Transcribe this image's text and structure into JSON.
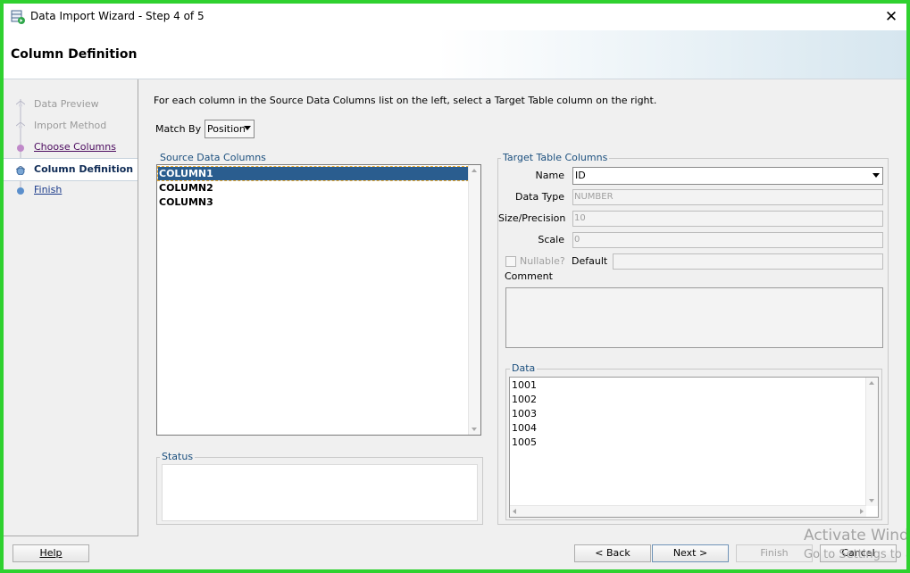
{
  "window": {
    "title": "Data Import Wizard - Step 4 of 5",
    "close_glyph": "✕"
  },
  "header": {
    "title": "Column Definition"
  },
  "nav": {
    "steps": [
      {
        "label": "Data Preview",
        "state": "disabled"
      },
      {
        "label": "Import Method",
        "state": "disabled"
      },
      {
        "label": "Choose Columns",
        "state": "link"
      },
      {
        "label": "Column Definition",
        "state": "current"
      },
      {
        "label": "Finish",
        "state": "link"
      }
    ]
  },
  "content": {
    "instruction": "For each column in the Source Data Columns list on the left, select a Target Table column on the right.",
    "match_by": {
      "label": "Match By",
      "value": "Position"
    },
    "source": {
      "title": "Source Data Columns",
      "items": [
        "COLUMN1",
        "COLUMN2",
        "COLUMN3"
      ],
      "selected": "COLUMN1"
    },
    "status": {
      "title": "Status"
    },
    "target": {
      "title": "Target Table Columns",
      "name_label": "Name",
      "name_value": "ID",
      "data_type_label": "Data Type",
      "data_type_value": "NUMBER",
      "size_label": "Size/Precision",
      "size_value": "10",
      "scale_label": "Scale",
      "scale_value": "0",
      "nullable_label": "Nullable?",
      "default_label": "Default",
      "default_value": "",
      "comment_label": "Comment"
    },
    "data": {
      "title": "Data",
      "rows": [
        "1001",
        "1002",
        "1003",
        "1004",
        "1005"
      ]
    }
  },
  "footer": {
    "help": "Help",
    "back": "< Back",
    "next": "Next >",
    "finish": "Finish",
    "cancel": "Cancel"
  },
  "watermark": {
    "line1": "Activate Windows",
    "line2": "Go to Settings to activate Windows."
  },
  "colors": {
    "frame": "#2fd12f",
    "selection": "#2a5d8f",
    "group_title": "#1b4f7e"
  }
}
